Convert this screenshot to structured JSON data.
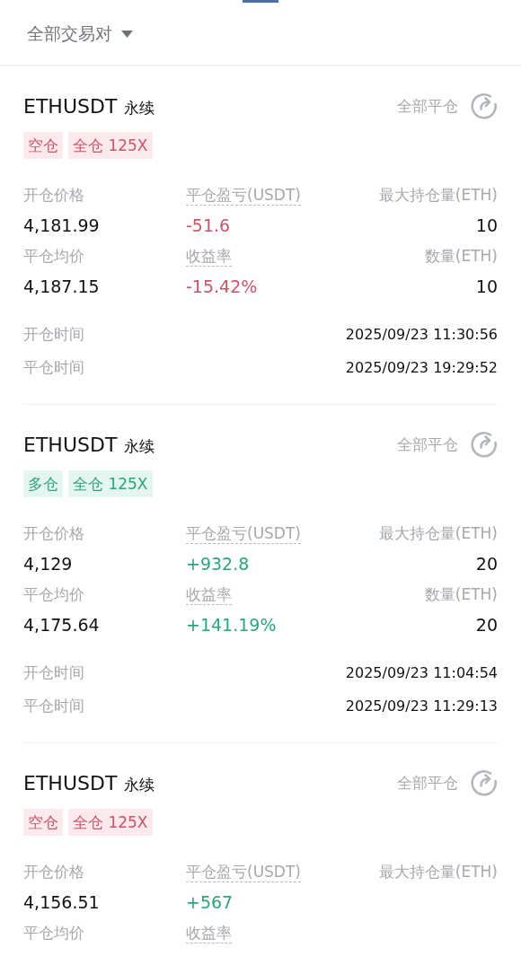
{
  "filter": {
    "label": "全部交易对"
  },
  "positions": [
    {
      "symbol": "ETHUSDT",
      "contract": "永续",
      "close_all": "全部平仓",
      "kind": "short",
      "tags": [
        "空仓",
        "全仓 125X"
      ],
      "stats": [
        {
          "label": "开仓价格",
          "value": "4,181.99",
          "kind": "plain"
        },
        {
          "label": "平仓盈亏(USDT)",
          "value": "-51.6",
          "kind": "pnl"
        },
        {
          "label": "最大持仓量(ETH)",
          "value": "10",
          "kind": "plain"
        },
        {
          "label": "平仓均价",
          "value": "4,187.15",
          "kind": "plain"
        },
        {
          "label": "收益率",
          "value": "-15.42%",
          "kind": "pnl"
        },
        {
          "label": "数量(ETH)",
          "value": "10",
          "kind": "plain"
        }
      ],
      "times": [
        {
          "label": "开仓时间",
          "value": "2025/09/23 11:30:56"
        },
        {
          "label": "平仓时间",
          "value": "2025/09/23 19:29:52"
        }
      ]
    },
    {
      "symbol": "ETHUSDT",
      "contract": "永续",
      "close_all": "全部平仓",
      "kind": "long",
      "tags": [
        "多仓",
        "全仓 125X"
      ],
      "stats": [
        {
          "label": "开仓价格",
          "value": "4,129",
          "kind": "plain"
        },
        {
          "label": "平仓盈亏(USDT)",
          "value": "+932.8",
          "kind": "pnl"
        },
        {
          "label": "最大持仓量(ETH)",
          "value": "20",
          "kind": "plain"
        },
        {
          "label": "平仓均价",
          "value": "4,175.64",
          "kind": "plain"
        },
        {
          "label": "收益率",
          "value": "+141.19%",
          "kind": "pnl"
        },
        {
          "label": "数量(ETH)",
          "value": "20",
          "kind": "plain"
        }
      ],
      "times": [
        {
          "label": "开仓时间",
          "value": "2025/09/23 11:04:54"
        },
        {
          "label": "平仓时间",
          "value": "2025/09/23 11:29:13"
        }
      ]
    },
    {
      "symbol": "ETHUSDT",
      "contract": "永续",
      "close_all": "全部平仓",
      "kind": "short",
      "tags": [
        "空仓",
        "全仓 125X"
      ],
      "stats": [
        {
          "label": "开仓价格",
          "value": "4,156.51",
          "kind": "plain"
        },
        {
          "label": "平仓盈亏(USDT)",
          "value": "+567",
          "kind": "pnl"
        },
        {
          "label": "最大持仓量(ETH)",
          "kind": "plain"
        },
        {
          "label": "平仓均价",
          "kind": "plain"
        },
        {
          "label": "收益率",
          "kind": "pnl"
        }
      ]
    }
  ]
}
